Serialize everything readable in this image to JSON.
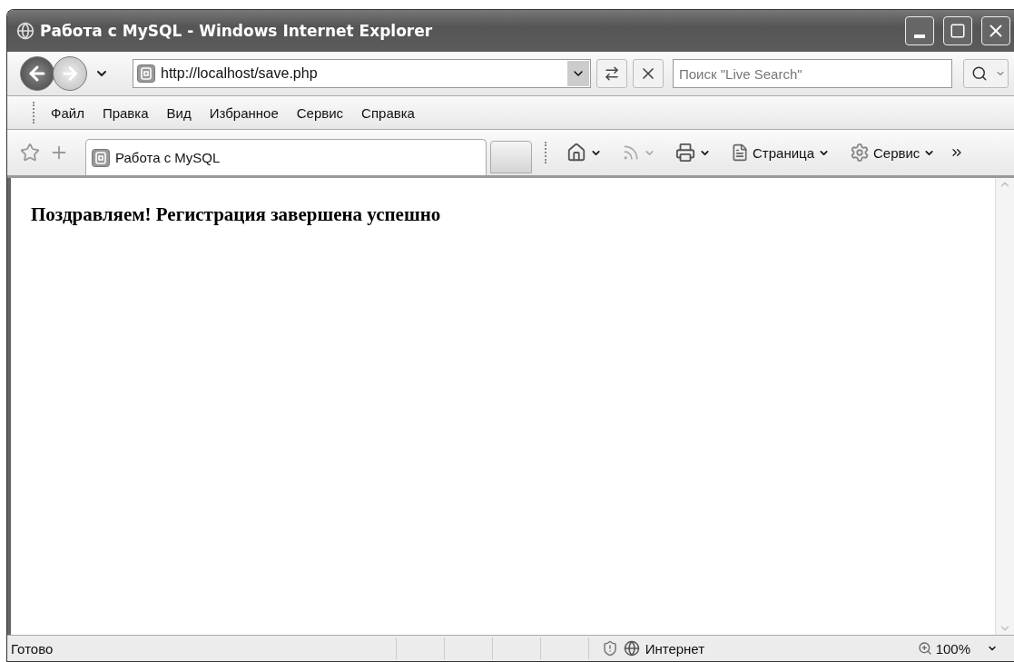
{
  "window": {
    "title": "Работа с MySQL - Windows Internet Explorer"
  },
  "address_bar": {
    "url": "http://localhost/save.php"
  },
  "search": {
    "placeholder": "Поиск \"Live Search\""
  },
  "menu": [
    "Файл",
    "Правка",
    "Вид",
    "Избранное",
    "Сервис",
    "Справка"
  ],
  "tabs": [
    {
      "label": "Работа с MySQL",
      "selected": true
    }
  ],
  "command_bar": [
    {
      "kind": "home",
      "disabled": false
    },
    {
      "kind": "feeds",
      "disabled": true
    },
    {
      "kind": "print",
      "disabled": false
    },
    {
      "kind": "page",
      "label": "Страница",
      "disabled": false
    },
    {
      "kind": "tools",
      "label": "Сервис",
      "disabled": false
    }
  ],
  "page": {
    "heading": "Поздравляем! Регистрация завершена успешно"
  },
  "status_bar": {
    "text": "Готово",
    "zone": "Интернет",
    "zoom": "100%"
  }
}
